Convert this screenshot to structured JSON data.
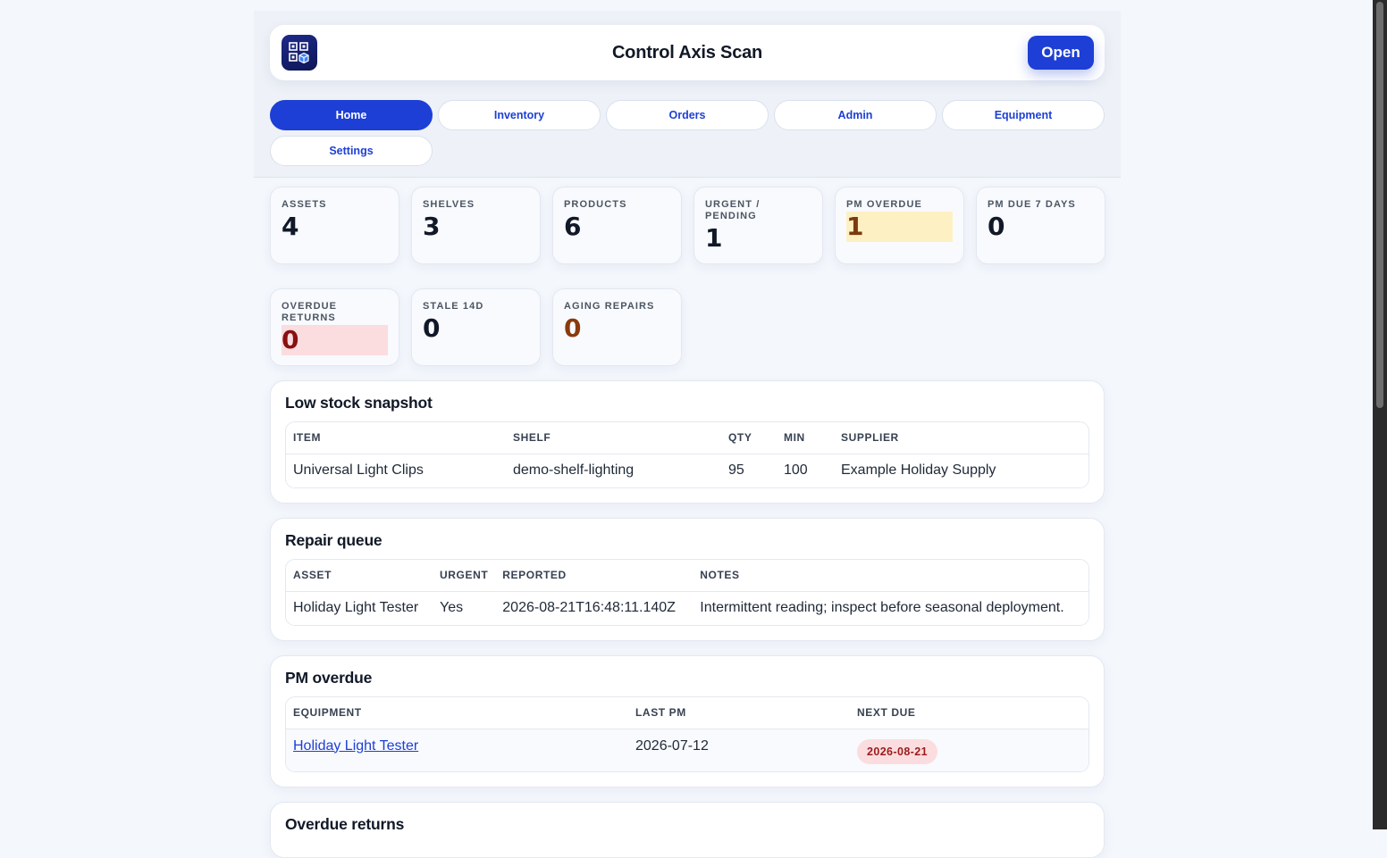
{
  "app": {
    "title": "Control Axis Scan",
    "open_label": "Open",
    "logo_icon": "qr-box-icon"
  },
  "tabs": [
    {
      "label": "Home",
      "active": true
    },
    {
      "label": "Inventory",
      "active": false
    },
    {
      "label": "Orders",
      "active": false
    },
    {
      "label": "Admin",
      "active": false
    },
    {
      "label": "Equipment",
      "active": false
    },
    {
      "label": "Settings",
      "active": false
    }
  ],
  "stats": [
    {
      "label": "Assets",
      "value": "4"
    },
    {
      "label": "Shelves",
      "value": "3"
    },
    {
      "label": "Products",
      "value": "6"
    },
    {
      "label": "Urgent / Pending",
      "value": "1"
    },
    {
      "label": "PM Overdue",
      "value": "1"
    },
    {
      "label": "PM Due 7 Days",
      "value": "0"
    },
    {
      "label": "Overdue Returns",
      "value": "0"
    },
    {
      "label": "Stale 14D",
      "value": "0"
    },
    {
      "label": "Aging Repairs",
      "value": "0"
    }
  ],
  "low_stock": {
    "title": "Low stock snapshot",
    "columns": [
      "ITEM",
      "SHELF",
      "QTY",
      "MIN",
      "SUPPLIER"
    ],
    "rows": [
      [
        "Universal Light Clips",
        "demo-shelf-lighting",
        "95",
        "100",
        "Example Holiday Supply"
      ]
    ]
  },
  "repair_queue": {
    "title": "Repair queue",
    "columns": [
      "ASSET",
      "URGENT",
      "REPORTED",
      "NOTES"
    ],
    "rows": [
      [
        "Holiday Light Tester",
        "Yes",
        "2026-08-21T16:48:11.140Z",
        "Intermittent reading; inspect before seasonal deployment."
      ]
    ]
  },
  "pm_overdue": {
    "title": "PM overdue",
    "columns": [
      "EQUIPMENT",
      "LAST PM",
      "NEXT DUE"
    ],
    "rows": [
      [
        "Holiday Light Tester",
        "2026-07-12",
        "2026-08-21"
      ]
    ]
  },
  "overdue_returns": {
    "title": "Overdue returns"
  },
  "colors": {
    "accent": "#1d3fd6",
    "warn_bg": "#fdf1c4",
    "danger_bg": "#fbdde0"
  }
}
